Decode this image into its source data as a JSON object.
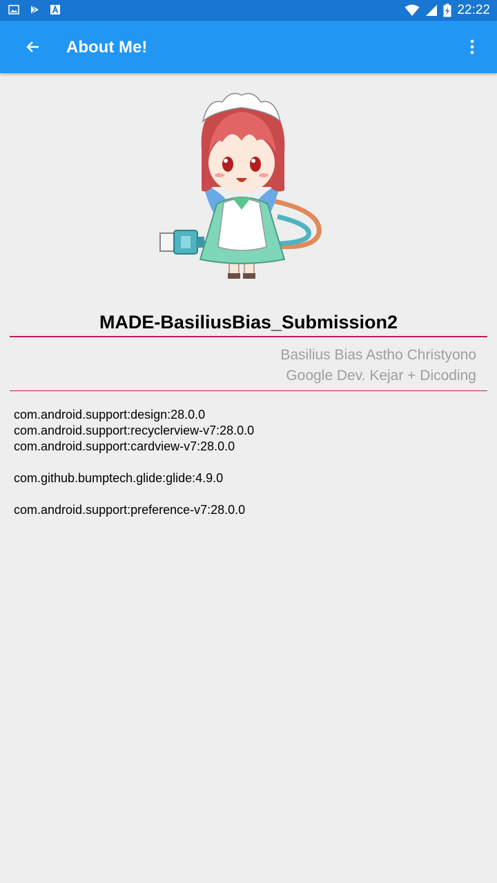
{
  "status_bar": {
    "time": "22:22",
    "left_icons": [
      "image-icon",
      "play-store-icon",
      "font-icon"
    ],
    "right_icons": [
      "wifi-icon",
      "signal-icon",
      "battery-charging-icon"
    ]
  },
  "app_bar": {
    "title": "About Me!",
    "color": "#2196f3",
    "back_icon": "arrow-back-icon",
    "menu_icon": "more-vert-icon"
  },
  "profile": {
    "avatar": "chibi-maid-cable-image",
    "project_title": "MADE-BasiliusBias_Submission2",
    "author_name": "Basilius Bias Astho Christyono",
    "affiliation": "Google Dev. Kejar + Dicoding",
    "accent": "#c2185b"
  },
  "dependencies": {
    "group1": [
      "com.android.support:design:28.0.0",
      "com.android.support:recyclerview-v7:28.0.0",
      "com.android.support:cardview-v7:28.0.0"
    ],
    "group2": [
      "com.github.bumptech.glide:glide:4.9.0"
    ],
    "group3": [
      "com.android.support:preference-v7:28.0.0"
    ]
  }
}
